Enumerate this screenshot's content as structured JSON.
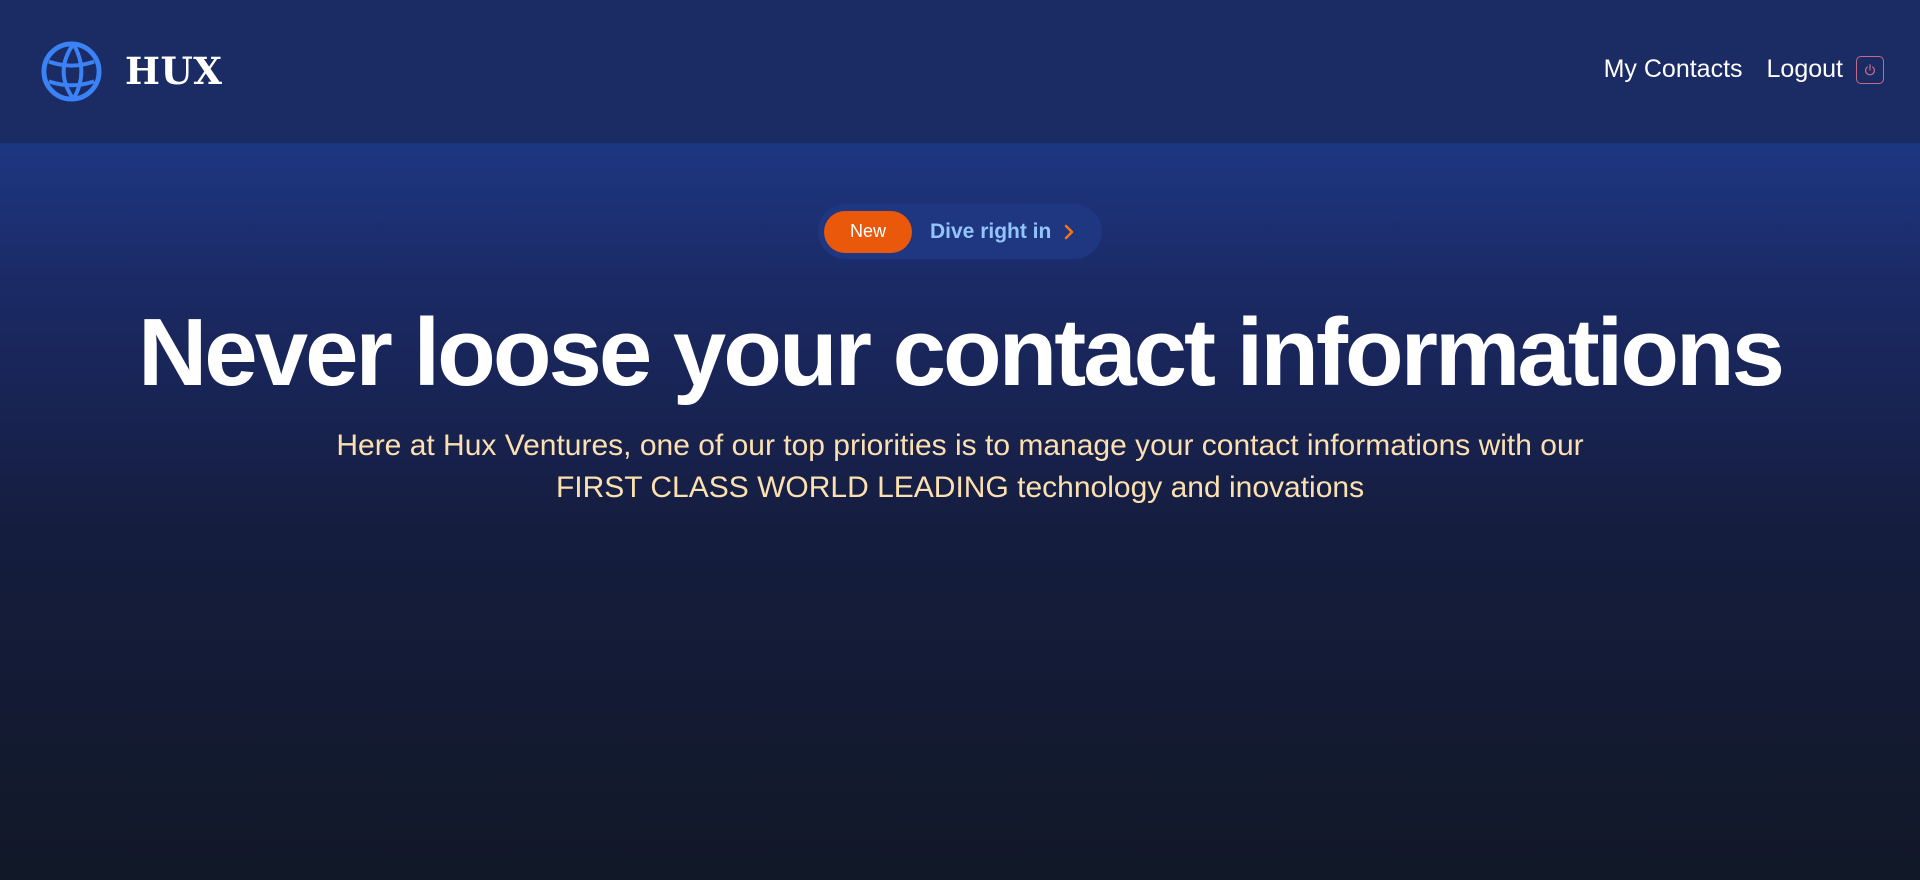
{
  "nav": {
    "brand": "HUX",
    "logo_icon": "globe-icon",
    "links": [
      "My Contacts",
      "Logout"
    ],
    "logout_icon": "power-icon"
  },
  "hero": {
    "badge": "New",
    "cta": "Dive right in",
    "cta_icon": "chevron-right-icon",
    "headline": "Never loose your contact informations",
    "subtext": "Here at Hux Ventures, one of our top priorities is to manage your contact informations with our FIRST CLASS WORLD LEADING technology and inovations"
  },
  "colors": {
    "accent_blue": "#3b82f6",
    "badge_orange": "#ea580c",
    "cta_text": "#93c5fd",
    "subtext": "#fde0b0"
  }
}
